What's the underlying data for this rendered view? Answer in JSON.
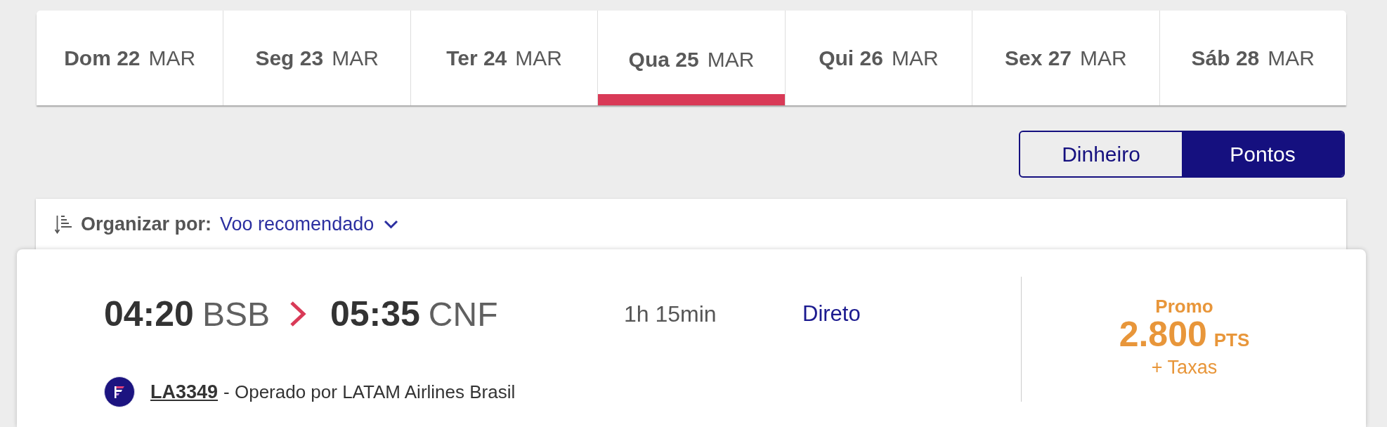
{
  "date_tabs": [
    {
      "day": "Dom 22",
      "month": "MAR",
      "selected": false
    },
    {
      "day": "Seg 23",
      "month": "MAR",
      "selected": false
    },
    {
      "day": "Ter 24",
      "month": "MAR",
      "selected": false
    },
    {
      "day": "Qua 25",
      "month": "MAR",
      "selected": true
    },
    {
      "day": "Qui 26",
      "month": "MAR",
      "selected": false
    },
    {
      "day": "Sex 27",
      "month": "MAR",
      "selected": false
    },
    {
      "day": "Sáb 28",
      "month": "MAR",
      "selected": false
    }
  ],
  "fare_toggle": [
    {
      "label": "Dinheiro",
      "selected": false
    },
    {
      "label": "Pontos",
      "selected": true
    }
  ],
  "sort": {
    "label": "Organizar por:",
    "value": "Voo recomendado"
  },
  "flights": [
    {
      "departure_time": "04:20",
      "departure_airport": "BSB",
      "arrival_time": "05:35",
      "arrival_airport": "CNF",
      "duration": "1h 15min",
      "stops": "Direto",
      "flight_number": "LA3349",
      "operator": "- Operado por LATAM Airlines Brasil",
      "fare_label": "Promo",
      "price": "2.800",
      "price_unit": "PTS",
      "price_note": "+ Taxas"
    }
  ]
}
